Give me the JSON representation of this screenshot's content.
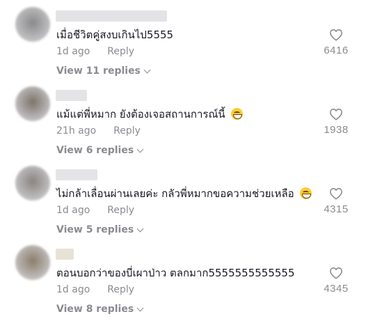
{
  "comments": [
    {
      "text": "เมื่อชีวิตคู่สงบเกินไป5555",
      "emoji": false,
      "time": "1d ago",
      "reply_label": "Reply",
      "view_replies": "View 11 replies",
      "likes": "6416",
      "username_color": "#e3e3e6",
      "avatar_color": "#8a8a8a"
    },
    {
      "text": "แม้แต่พี่หมาก ยังต้องเจอสถานการณ์นี้",
      "emoji": true,
      "time": "21h ago",
      "reply_label": "Reply",
      "view_replies": "View 6 replies",
      "likes": "1938",
      "username_color": "#e4e4e7",
      "avatar_color": "#7d736a"
    },
    {
      "text": "ไม่กล้าเลื่อนผ่านเลยค่ะ กลัวพี่หมากขอความช่วยเหลือ",
      "emoji": true,
      "time": "1d ago",
      "reply_label": "Reply",
      "view_replies": "View 5 replies",
      "likes": "4315",
      "username_color": "#e4e4e7",
      "avatar_color": "#8b8480"
    },
    {
      "text": "ตอนบอกว่าของบี่เผาป่าว ตลกมาก5555555555555",
      "emoji": false,
      "time": "1d ago",
      "reply_label": "Reply",
      "view_replies": "View 8 replies",
      "likes": "4345",
      "username_color": "#e8e2d6",
      "avatar_color": "#8c7d6a"
    }
  ],
  "icons": {
    "like": "heart-outline-icon",
    "expand": "chevron-down-icon",
    "emoji": "grinning-face-icon"
  },
  "colors": {
    "text": "#161823",
    "muted": "#8a8b91",
    "background": "#ffffff"
  }
}
